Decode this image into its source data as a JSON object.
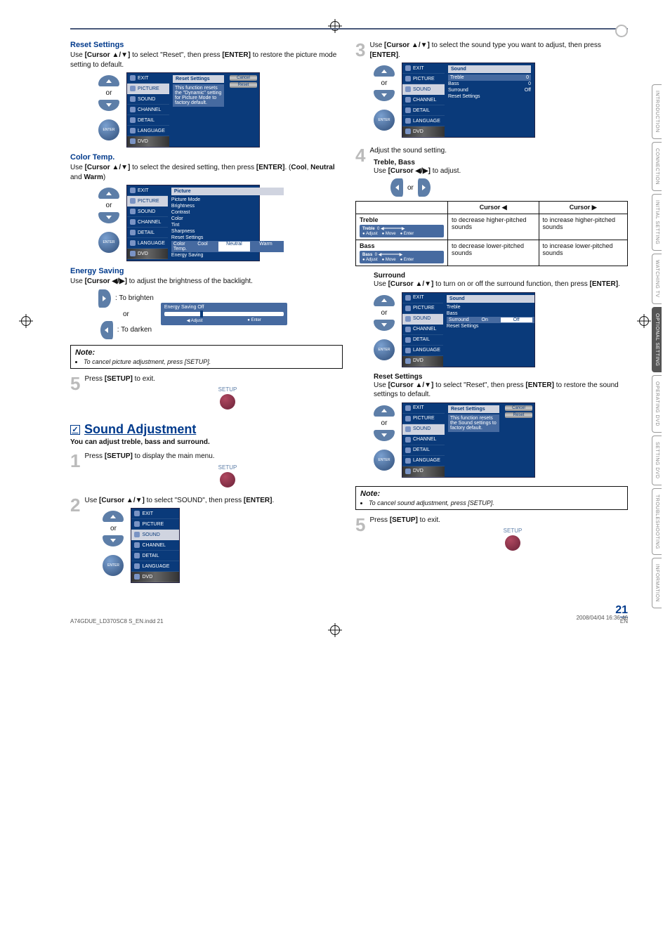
{
  "tabs": [
    "INTRODUCTION",
    "CONNECTION",
    "INITIAL SETTING",
    "WATCHING TV",
    "OPTIONAL SETTING",
    "OPERATING DVD",
    "SETTING DVD",
    "TROUBLESHOOTING",
    "INFORMATION"
  ],
  "active_tab_index": 4,
  "left": {
    "reset": {
      "title": "Reset Settings",
      "text_parts": [
        "Use ",
        "[Cursor ▲/▼]",
        " to select \"Reset\", then press ",
        "[ENTER]",
        " to restore the picture mode setting to default."
      ],
      "osd": {
        "menu": [
          "EXIT",
          "PICTURE",
          "SOUND",
          "CHANNEL",
          "DETAIL",
          "LANGUAGE",
          "DVD"
        ],
        "sel_index": 1,
        "panel_title": "Reset Settings",
        "panel_text": "This function resets the \"Dynamic\" setting for Picture Mode to factory default.",
        "buttons": [
          "Cancel",
          "Reset"
        ]
      }
    },
    "color": {
      "title": "Color Temp.",
      "text_parts": [
        "Use ",
        "[Cursor ▲/▼]",
        " to select the desired setting, then press ",
        "[ENTER]",
        ". (",
        "Cool",
        ", ",
        "Neutral",
        " and ",
        "Warm",
        ")"
      ],
      "osd": {
        "menu": [
          "EXIT",
          "PICTURE",
          "SOUND",
          "CHANNEL",
          "DETAIL",
          "LANGUAGE",
          "DVD"
        ],
        "sel_index": 1,
        "panel_title": "Picture",
        "rows": [
          {
            "l": "Picture Mode",
            "r": ""
          },
          {
            "l": "Brightness",
            "r": ""
          },
          {
            "l": "Contrast",
            "r": ""
          },
          {
            "l": "Color",
            "r": ""
          },
          {
            "l": "Tint",
            "r": ""
          },
          {
            "l": "Sharpness",
            "r": ""
          },
          {
            "l": "Reset Settings",
            "r": ""
          },
          {
            "l": "Color Temp.",
            "r": "Neutral",
            "hl": true,
            "opts": [
              "Cool",
              "Neutral",
              "Warm"
            ]
          },
          {
            "l": "Energy Saving",
            "r": "Warm"
          }
        ]
      }
    },
    "energy": {
      "title": "Energy Saving",
      "text_parts": [
        "Use ",
        "[Cursor ◀/▶]",
        " to adjust the brightness of the backlight."
      ],
      "brighten": ": To brighten",
      "darken": ": To darken",
      "or": "or",
      "bar_title": "Energy Saving  Off",
      "bar_foot": [
        "Adjust",
        "Enter"
      ]
    },
    "note": {
      "title": "Note:",
      "item": "To cancel picture adjustment, press [SETUP]."
    },
    "step5": {
      "num": "5",
      "text_parts": [
        "Press ",
        "[SETUP]",
        " to exit."
      ],
      "setup": "SETUP"
    },
    "sound_heading": "Sound Adjustment",
    "sound_sub": "You can adjust treble, bass and surround.",
    "step1": {
      "num": "1",
      "text_parts": [
        "Press ",
        "[SETUP]",
        " to display the main menu."
      ],
      "setup": "SETUP"
    },
    "step2": {
      "num": "2",
      "text_parts": [
        "Use ",
        "[Cursor ▲/▼]",
        " to select \"SOUND\", then press ",
        "[ENTER]",
        "."
      ],
      "or": "or",
      "enter": "ENTER",
      "osd": {
        "menu": [
          "EXIT",
          "PICTURE",
          "SOUND",
          "CHANNEL",
          "DETAIL",
          "LANGUAGE",
          "DVD"
        ],
        "sel_index": 2
      }
    },
    "or": "or",
    "enter": "ENTER"
  },
  "right": {
    "step3": {
      "num": "3",
      "text_parts": [
        "Use ",
        "[Cursor ▲/▼]",
        " to select the sound type you want to adjust, then press ",
        "[ENTER]",
        "."
      ],
      "or": "or",
      "enter": "ENTER",
      "osd": {
        "menu": [
          "EXIT",
          "PICTURE",
          "SOUND",
          "CHANNEL",
          "DETAIL",
          "LANGUAGE",
          "DVD"
        ],
        "sel_index": 2,
        "panel_title": "Sound",
        "rows": [
          {
            "l": "Treble",
            "r": "0",
            "hl": true
          },
          {
            "l": "Bass",
            "r": "0"
          },
          {
            "l": "Surround",
            "r": "Off"
          },
          {
            "l": "Reset Settings",
            "r": ""
          }
        ]
      }
    },
    "step4": {
      "num": "4",
      "head": "Adjust the sound setting.",
      "sub1": "Treble, Bass",
      "sub1_text_parts": [
        "Use ",
        "[Cursor ◀/▶]",
        " to adjust."
      ],
      "or": "or",
      "table": {
        "headers": [
          "",
          "Cursor ◀",
          "Cursor ▶"
        ],
        "rows": [
          {
            "label": "Treble",
            "osd_label": "Treble",
            "osd_val": "0",
            "foot": [
              "Adjust",
              "Move",
              "Enter"
            ],
            "left": "to decrease higher-pitched sounds",
            "right": "to increase higher-pitched sounds"
          },
          {
            "label": "Bass",
            "osd_label": "Bass",
            "osd_val": "0",
            "foot": [
              "Adjust",
              "Move",
              "Enter"
            ],
            "left": "to decrease lower-pitched sounds",
            "right": "to increase lower-pitched sounds"
          }
        ]
      },
      "surround": {
        "title": "Surround",
        "text_parts": [
          "Use ",
          "[Cursor ▲/▼]",
          " to turn on or off the surround function, then press ",
          "[ENTER]",
          "."
        ],
        "or": "or",
        "enter": "ENTER",
        "osd": {
          "menu": [
            "EXIT",
            "PICTURE",
            "SOUND",
            "CHANNEL",
            "DETAIL",
            "LANGUAGE",
            "DVD"
          ],
          "sel_index": 2,
          "panel_title": "Sound",
          "rows": [
            {
              "l": "Treble",
              "r": ""
            },
            {
              "l": "Bass",
              "r": ""
            },
            {
              "l": "Surround",
              "r": "",
              "hl": true,
              "opts": [
                "On",
                "Off"
              ]
            },
            {
              "l": "Reset Settings",
              "r": ""
            }
          ]
        }
      },
      "reset": {
        "title": "Reset Settings",
        "text_parts": [
          "Use ",
          "[Cursor ▲/▼]",
          " to select \"Reset\", then press ",
          "[ENTER]",
          " to restore the sound settings to default."
        ],
        "or": "or",
        "enter": "ENTER",
        "osd": {
          "menu": [
            "EXIT",
            "PICTURE",
            "SOUND",
            "CHANNEL",
            "DETAIL",
            "LANGUAGE",
            "DVD"
          ],
          "sel_index": 2,
          "panel_title": "Reset Settings",
          "panel_text": "This function resets the Sound settings to factory default.",
          "buttons": [
            "Cancel",
            "Reset"
          ]
        }
      }
    },
    "note": {
      "title": "Note:",
      "item": "To cancel sound adjustment, press [SETUP]."
    },
    "step5": {
      "num": "5",
      "text_parts": [
        "Press ",
        "[SETUP]",
        " to exit."
      ],
      "setup": "SETUP"
    }
  },
  "footer": {
    "file": "A74GDUE_LD370SC8 S_EN.indd   21",
    "date": "2008/04/04   16:36:46",
    "page": "21",
    "en": "EN"
  }
}
